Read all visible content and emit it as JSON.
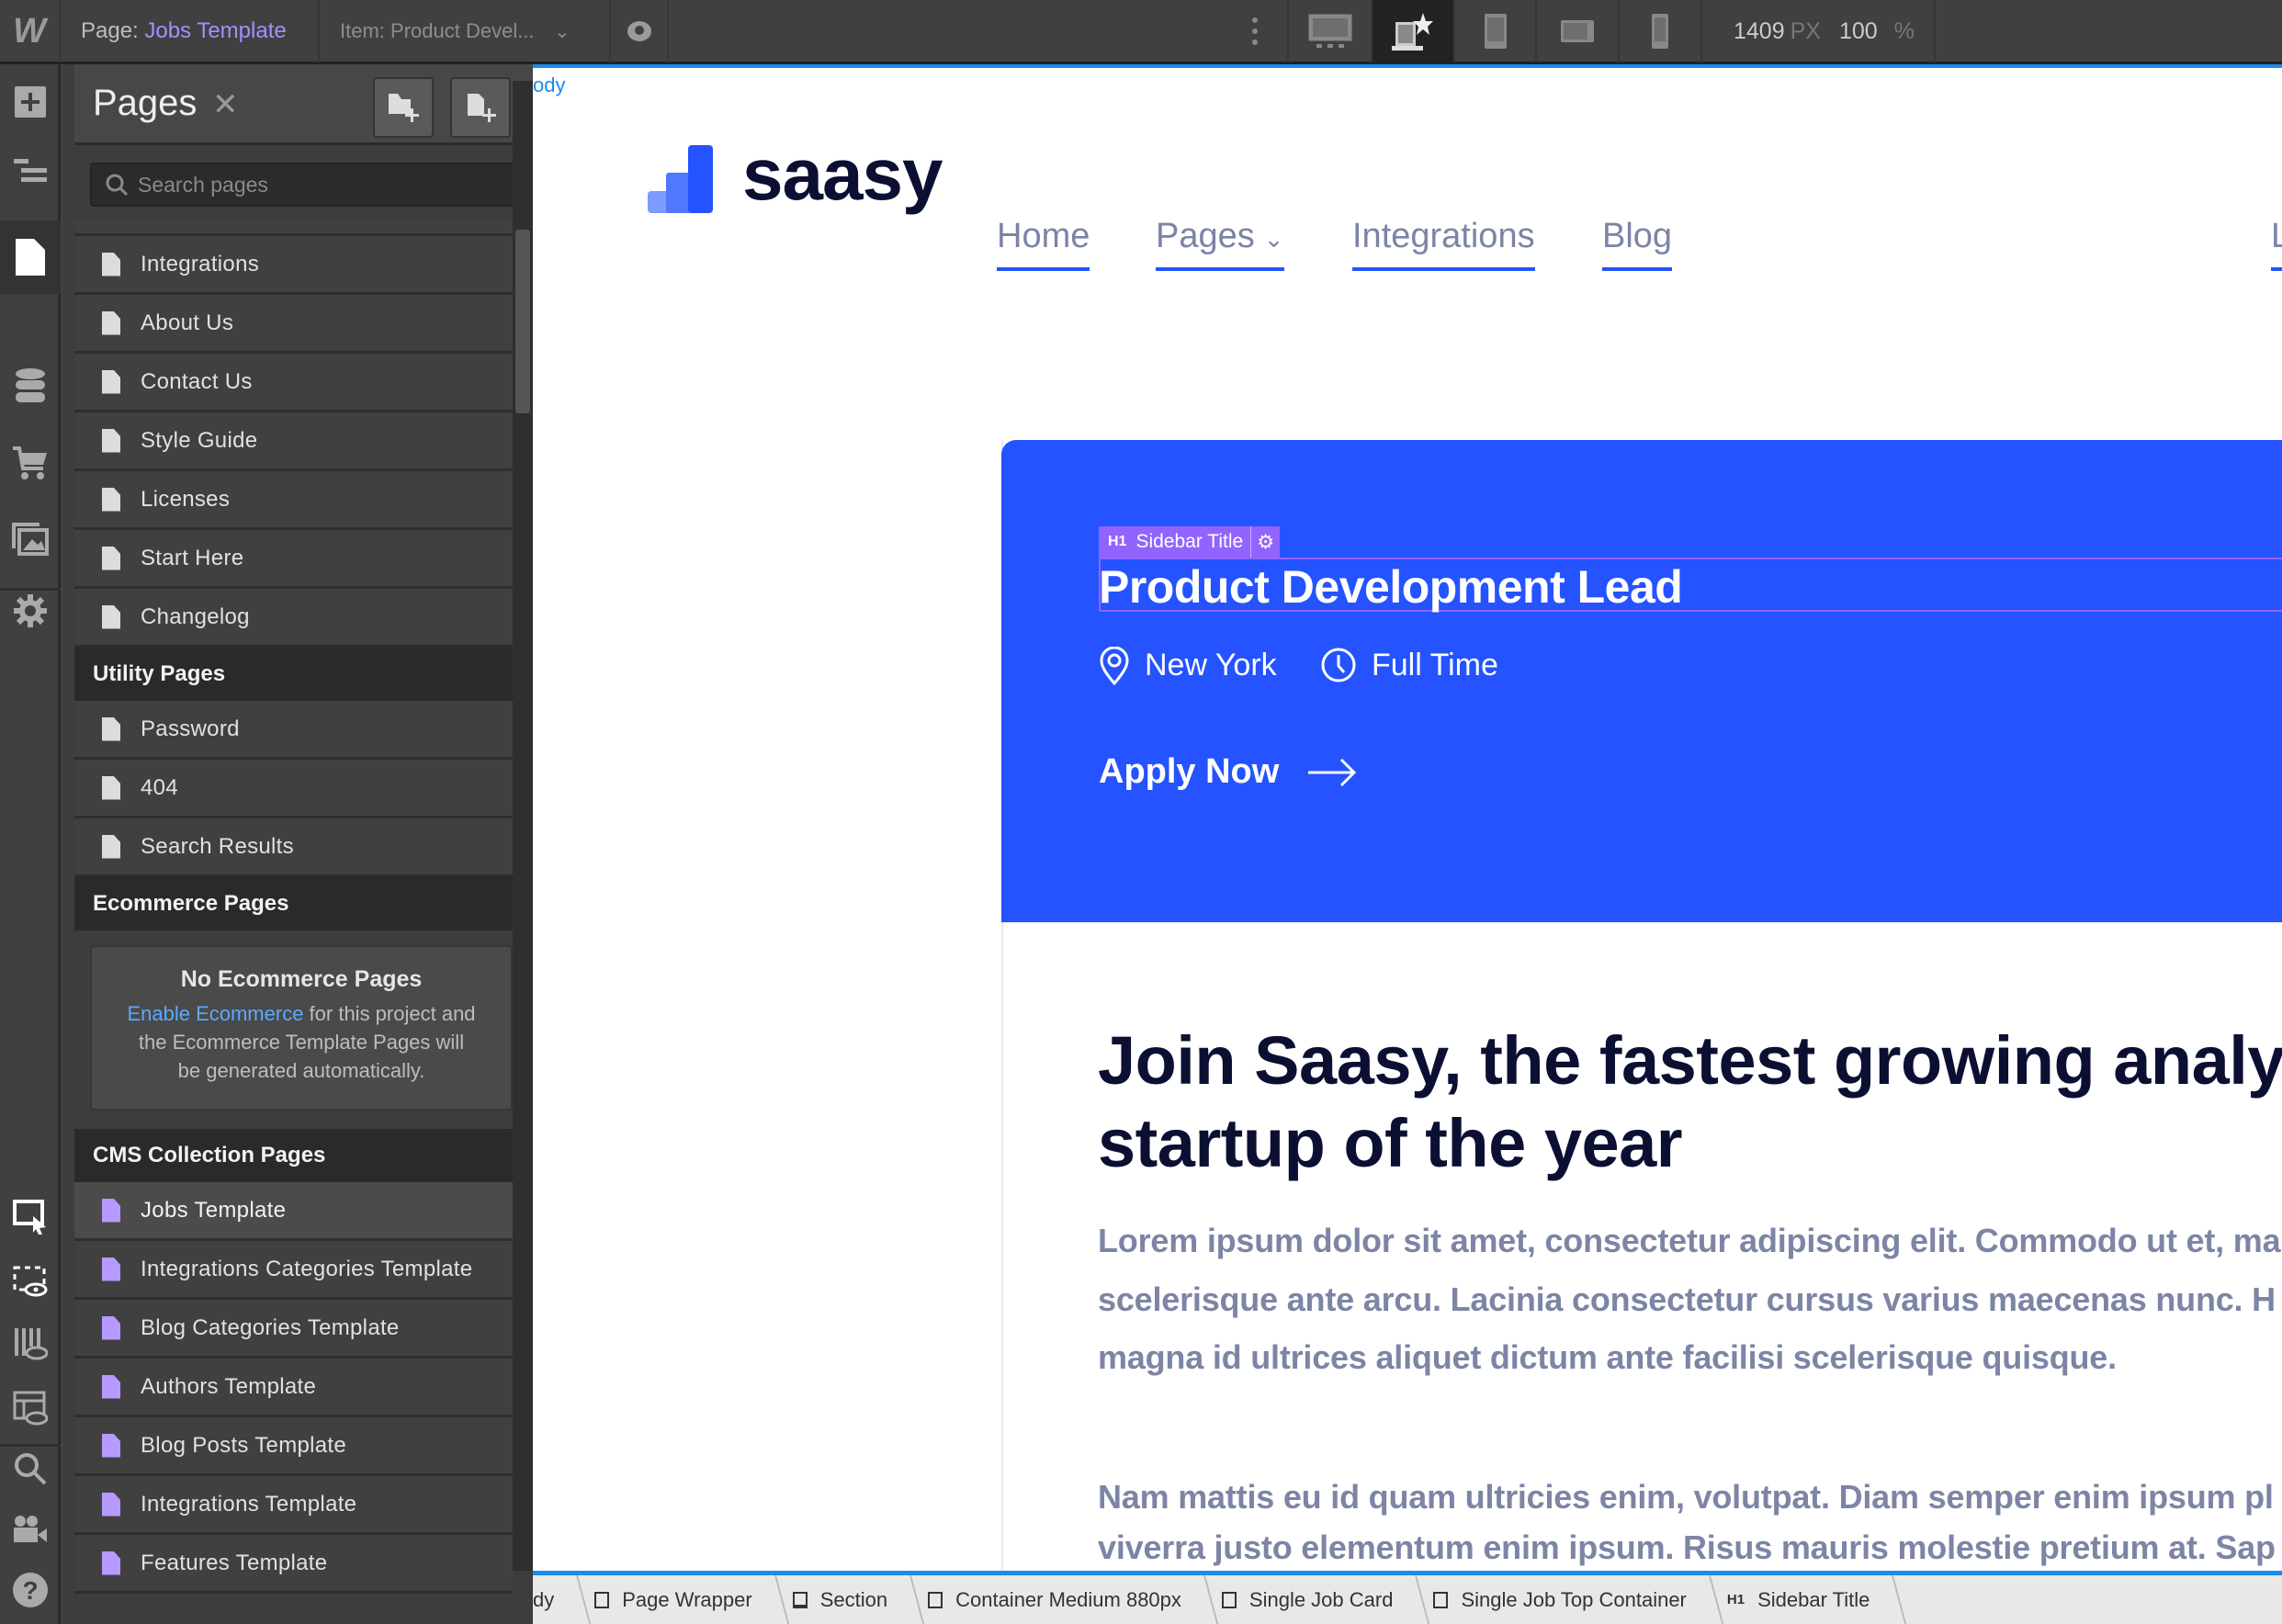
{
  "topbar": {
    "page_label": "Page:",
    "page_name": "Jobs Template",
    "item_label": "Item:",
    "item_name": "Product Devel...",
    "width_value": "1409",
    "width_unit": "PX",
    "zoom_value": "100",
    "zoom_unit": "%"
  },
  "panel": {
    "title": "Pages",
    "search_placeholder": "Search pages",
    "static_pages": [
      "Integrations",
      "About Us",
      "Contact Us",
      "Style Guide",
      "Licenses",
      "Start Here",
      "Changelog"
    ],
    "utility_header": "Utility Pages",
    "utility_pages": [
      "Password",
      "404",
      "Search Results"
    ],
    "ecommerce_header": "Ecommerce Pages",
    "ecommerce_empty": {
      "title": "No Ecommerce Pages",
      "link": "Enable Ecommerce",
      "text1": " for this project and",
      "text2": "the Ecommerce Template Pages will",
      "text3": "be generated automatically."
    },
    "cms_header": "CMS Collection Pages",
    "cms_pages": [
      "Jobs Template",
      "Integrations Categories Template",
      "Blog Categories Template",
      "Authors Template",
      "Blog Posts Template",
      "Integrations Template",
      "Features Template"
    ],
    "selected": "Jobs Template"
  },
  "canvas": {
    "body_label": "ody",
    "logo_text": "saasy",
    "nav": [
      "Home",
      "Pages",
      "Integrations",
      "Blog"
    ],
    "element_tag": {
      "type": "H1",
      "name": "Sidebar Title"
    },
    "job_title": "Product Development Lead",
    "location": "New York",
    "job_type": "Full Time",
    "apply": "Apply Now",
    "heading_lines": [
      "Join Saasy, the fastest growing analy",
      "startup of the year"
    ],
    "para1": [
      "Lorem ipsum dolor sit amet, consectetur adipiscing elit. Commodo ut et, ma",
      "scelerisque ante arcu. Lacinia consectetur cursus varius maecenas nunc. H",
      "magna id ultrices aliquet dictum ante facilisi scelerisque quisque."
    ],
    "para2": [
      "Nam mattis eu id quam ultricies enim, volutpat. Diam semper enim ipsum pl",
      "viverra justo elementum enim ipsum. Risus mauris molestie pretium at. Sap"
    ],
    "card_color": "#2453ff"
  },
  "breadcrumbs": [
    {
      "label": "dy",
      "icon": "none"
    },
    {
      "label": "Page Wrapper",
      "icon": "box"
    },
    {
      "label": "Section",
      "icon": "section"
    },
    {
      "label": "Container Medium 880px",
      "icon": "box"
    },
    {
      "label": "Single Job Card",
      "icon": "box"
    },
    {
      "label": "Single Job Top Container",
      "icon": "box"
    },
    {
      "label": "Sidebar Title",
      "icon": "h1"
    }
  ]
}
